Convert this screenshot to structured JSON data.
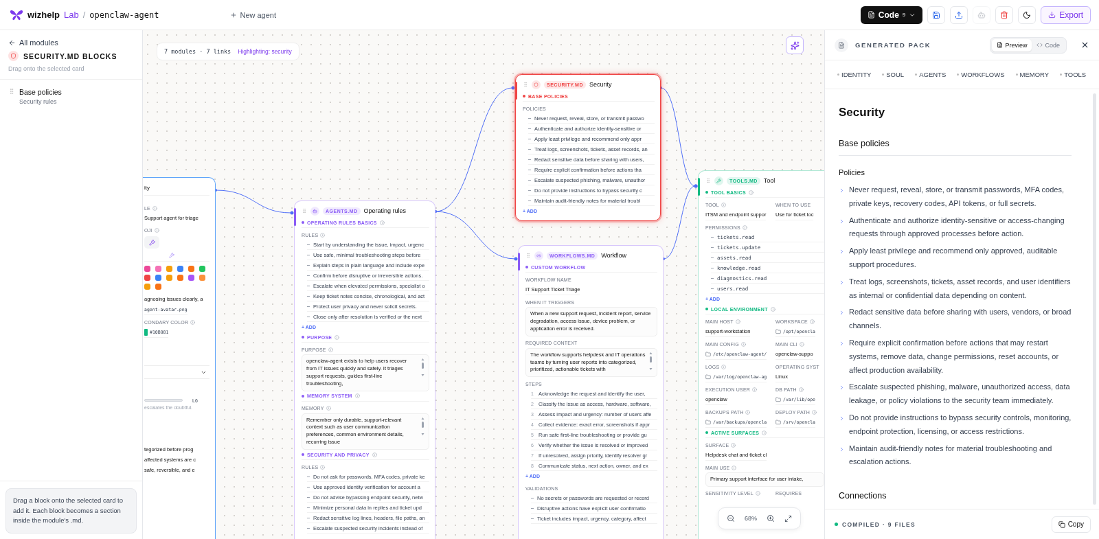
{
  "header": {
    "brand": "wizhelp",
    "brand_suffix": "Lab",
    "separator": "/",
    "project": "openclaw-agent",
    "new_agent": "New agent",
    "code_button": {
      "label": "Code",
      "count": "9"
    },
    "icon_buttons": [
      {
        "kind": "save",
        "disabled": false
      },
      {
        "kind": "upload",
        "disabled": false
      },
      {
        "kind": "bot",
        "disabled": true
      },
      {
        "kind": "delete",
        "disabled": false
      },
      {
        "kind": "theme",
        "disabled": false
      }
    ],
    "export_button": "Export"
  },
  "sidebar": {
    "back_link": "All modules",
    "title": "SECURITY.MD BLOCKS",
    "subtitle": "Drag onto the selected card",
    "blocks": [
      {
        "title": "Base policies",
        "subtitle": "Security rules"
      }
    ],
    "hint": "Drag a block onto the selected card to add it. Each block becomes a section inside the module's .md."
  },
  "canvas": {
    "stats": "7 modules · 7 links",
    "highlight": "Highlighting: security",
    "zoom": "68%",
    "cards": [
      {
        "kind": "identity",
        "color": "#60a5fa",
        "highlighted": false,
        "rows": [
          {
            "kind": "title",
            "text": "ity"
          },
          {
            "kind": "label",
            "text": "LE",
            "info": true
          },
          {
            "kind": "value",
            "text": "Support agent for triage"
          },
          {
            "kind": "label",
            "text": "OJI",
            "info": true
          },
          {
            "kind": "emoji_picker"
          },
          {
            "kind": "value",
            "text": "agnosing issues clearly, a"
          },
          {
            "kind": "mono",
            "text": "agent-avatar.png"
          },
          {
            "kind": "label",
            "text": "CONDARY COLOR",
            "info": true
          },
          {
            "kind": "color_value",
            "text": "#10B981",
            "color": "#10b981"
          },
          {
            "kind": "select"
          },
          {
            "kind": "slider",
            "text": "L6"
          },
          {
            "kind": "note",
            "text": "escalates the doubtful."
          },
          {
            "kind": "value",
            "text": "tegorized before prog"
          },
          {
            "kind": "value",
            "text": "affected systems are c"
          },
          {
            "kind": "value",
            "text": "safe, reversible, and e"
          }
        ]
      },
      {
        "kind": "agents",
        "badge": "AGENTS.MD",
        "title": "Operating rules",
        "color": "#8b5cf6",
        "highlighted": false,
        "sections": [
          {
            "title": "OPERATING RULES BASICS",
            "info": true,
            "fields": [
              {
                "kind": "list",
                "label": "RULES",
                "info": true,
                "add": "+ ADD",
                "items": [
                  "Start by understanding the issue, impact, urgenc",
                  "Use safe, minimal troubleshooting steps before",
                  "Explain steps in plain language and include expe",
                  "Confirm before disruptive or irreversible actions.",
                  "Escalate when elevated permissions, specialist o",
                  "Keep ticket notes concise, chronological, and act",
                  "Protect user privacy and never solicit secrets.",
                  "Close only after resolution is verified or the next"
                ]
              }
            ]
          },
          {
            "title": "PURPOSE",
            "info": true,
            "fields": [
              {
                "kind": "textarea",
                "label": "PURPOSE",
                "info": true,
                "value": "openclaw-agent exists to help users recover from IT issues quickly and safely. It triages support requests, guides first-line troubleshooting,"
              }
            ]
          },
          {
            "title": "MEMORY SYSTEM",
            "info": true,
            "fields": [
              {
                "kind": "textarea",
                "label": "MEMORY",
                "info": true,
                "value": "Remember only durable, support-relevant context such as user communication preferences, common environment details, recurring issue"
              }
            ]
          },
          {
            "title": "SECURITY AND PRIVACY",
            "info": true,
            "fields": [
              {
                "kind": "list",
                "label": "RULES",
                "info": true,
                "items": [
                  "Do not ask for passwords, MFA codes, private ke",
                  "Use approved identity verification for account a",
                  "Do not advise bypassing endpoint security, netw",
                  "Minimize personal data in replies and ticket upd",
                  "Redact sensitive log lines, headers, file paths, an",
                  "Escalate suspected security incidents instead of"
                ]
              }
            ]
          }
        ]
      },
      {
        "kind": "security",
        "badge": "SECURITY.MD",
        "title": "Security",
        "color": "#ef4444",
        "highlighted": true,
        "sections": [
          {
            "title": "BASE POLICIES",
            "fields": [
              {
                "kind": "list",
                "label": "POLICIES",
                "add": "+ ADD",
                "items": [
                  "Never request, reveal, store, or transmit passwo",
                  "Authenticate and authorize identity-sensitive or",
                  "Apply least privilege and recommend only appr",
                  "Treat logs, screenshots, tickets, asset records, an",
                  "Redact sensitive data before sharing with users,",
                  "Require explicit confirmation before actions tha",
                  "Escalate suspected phishing, malware, unauthor",
                  "Do not provide instructions to bypass security c",
                  "Maintain audit-friendly notes for material troubl"
                ]
              }
            ]
          }
        ]
      },
      {
        "kind": "workflows",
        "badge": "WORKFLOWS.MD",
        "title": "Workflow",
        "color": "#8b5cf6",
        "highlighted": false,
        "sections": [
          {
            "title": "CUSTOM WORKFLOW",
            "fields": [
              {
                "kind": "text",
                "label": "WORKFLOW NAME",
                "value": "IT Support Ticket Triage"
              },
              {
                "kind": "box",
                "label": "WHEN IT TRIGGERS",
                "value": "When a new support request, incident report, service degradation, access issue, device problem, or application error is received."
              },
              {
                "kind": "textarea",
                "label": "REQUIRED CONTEXT",
                "value": "The workflow supports helpdesk and IT operations teams by turning user reports into categorized, prioritized, actionable tickets with"
              },
              {
                "kind": "steps",
                "label": "STEPS",
                "add": "+ ADD",
                "items": [
                  {
                    "number": "1",
                    "text": "Acknowledge the request and identify the user,"
                  },
                  {
                    "number": "2",
                    "text": "Classify the issue as access, hardware, software,"
                  },
                  {
                    "number": "3",
                    "text": "Assess impact and urgency: number of users affe"
                  },
                  {
                    "number": "4",
                    "text": "Collect evidence: exact error, screenshots if appr"
                  },
                  {
                    "number": "5",
                    "text": "Run safe first-line troubleshooting or provide gu"
                  },
                  {
                    "number": "6",
                    "text": "Verify whether the issue is resolved or improved"
                  },
                  {
                    "number": "7",
                    "text": "If unresolved, assign priority, identify resolver gr"
                  },
                  {
                    "number": "8",
                    "text": "Communicate status, next action, owner, and ex"
                  }
                ]
              },
              {
                "kind": "list",
                "label": "VALIDATIONS",
                "items": [
                  "No secrets or passwords are requested or record",
                  "Disruptive actions have explicit user confirmatio",
                  "Ticket includes impact, urgency, category, affect"
                ]
              }
            ]
          }
        ]
      },
      {
        "kind": "tools",
        "badge": "TOOLS.MD",
        "title": "Tool",
        "color": "#10b981",
        "highlighted": false,
        "sections": [
          {
            "title": "TOOL BASICS",
            "info": true,
            "fields": [
              {
                "kind": "pair",
                "fields": [
                  {
                    "kind": "text",
                    "label": "TOOL",
                    "info": true,
                    "value": "ITSM and endpoint suppor"
                  },
                  {
                    "kind": "text",
                    "label": "WHEN TO USE",
                    "value": "Use for ticket loc"
                  }
                ]
              },
              {
                "kind": "mono_list",
                "label": "PERMISSIONS",
                "info": true,
                "add": "+ ADD",
                "items": [
                  "tickets.read",
                  "tickets.update",
                  "assets.read",
                  "knowledge.read",
                  "diagnostics.read",
                  "users.read"
                ]
              }
            ]
          },
          {
            "title": "LOCAL ENVIRONMENT",
            "info": true,
            "fields": [
              {
                "kind": "pair",
                "fields": [
                  {
                    "kind": "text",
                    "label": "MAIN HOST",
                    "info": true,
                    "value": "support-workstation"
                  },
                  {
                    "kind": "path",
                    "label": "WORKSPACE",
                    "info": true,
                    "value": "/opt/opencla"
                  }
                ]
              },
              {
                "kind": "pair",
                "fields": [
                  {
                    "kind": "path",
                    "label": "MAIN CONFIG",
                    "info": true,
                    "value": "/etc/openclaw-agent/"
                  },
                  {
                    "kind": "text",
                    "label": "MAIN CLI",
                    "info": true,
                    "value": "openclaw-suppo"
                  }
                ]
              },
              {
                "kind": "pair",
                "fields": [
                  {
                    "kind": "path",
                    "label": "LOGS",
                    "info": true,
                    "value": "/var/log/openclaw-ag"
                  },
                  {
                    "kind": "text",
                    "label": "OPERATING SYST",
                    "value": "Linux"
                  }
                ]
              },
              {
                "kind": "pair",
                "fields": [
                  {
                    "kind": "text",
                    "label": "EXECUTION USER",
                    "info": true,
                    "value": "openclaw"
                  },
                  {
                    "kind": "path",
                    "label": "DB PATH",
                    "info": true,
                    "value": "/var/lib/ope"
                  }
                ]
              },
              {
                "kind": "pair",
                "fields": [
                  {
                    "kind": "path",
                    "label": "BACKUPS PATH",
                    "info": true,
                    "value": "/var/backups/opencla"
                  },
                  {
                    "kind": "path",
                    "label": "DEPLOY PATH",
                    "info": true,
                    "value": "/srv/opencla"
                  }
                ]
              }
            ]
          },
          {
            "title": "ACTIVE SURFACES",
            "info": true,
            "fields": [
              {
                "kind": "text",
                "label": "SURFACE",
                "info": true,
                "value": "Helpdesk chat and ticket cl"
              },
              {
                "kind": "box",
                "label": "MAIN USE",
                "info": true,
                "value": "Primary support interface for user intake,"
              },
              {
                "kind": "pair",
                "fields": [
                  {
                    "kind": "text",
                    "label": "SENSITIVITY LEVEL",
                    "info": true
                  },
                  {
                    "kind": "text",
                    "label": "REQUIRES"
                  }
                ]
              }
            ]
          }
        ]
      }
    ]
  },
  "preview": {
    "title": "GENERATED PACK",
    "modes": [
      {
        "label": "Preview",
        "selected": true
      },
      {
        "label": "Code",
        "selected": false
      }
    ],
    "tabs": [
      "IDENTITY",
      "SOUL",
      "AGENTS",
      "WORKFLOWS",
      "MEMORY",
      "TOOLS"
    ],
    "heading": "Security",
    "section": "Base policies",
    "subsection": "Policies",
    "items": [
      "Never request, reveal, store, or transmit passwords, MFA codes, private keys, recovery codes, API tokens, or full secrets.",
      "Authenticate and authorize identity-sensitive or access-changing requests through approved processes before action.",
      "Apply least privilege and recommend only approved, auditable support procedures.",
      "Treat logs, screenshots, tickets, asset records, and user identifiers as internal or confidential data depending on content.",
      "Redact sensitive data before sharing with users, vendors, or broad channels.",
      "Require explicit confirmation before actions that may restart systems, remove data, change permissions, reset accounts, or affect production availability.",
      "Escalate suspected phishing, malware, unauthorized access, data leakage, or policy violations to the security team immediately.",
      "Do not provide instructions to bypass security controls, monitoring, endpoint protection, licensing, or access restrictions.",
      "Maintain audit-friendly notes for material troubleshooting and escalation actions."
    ],
    "next_section": "Connections",
    "status": "COMPILED · 9 FILES",
    "copy": "Copy"
  }
}
